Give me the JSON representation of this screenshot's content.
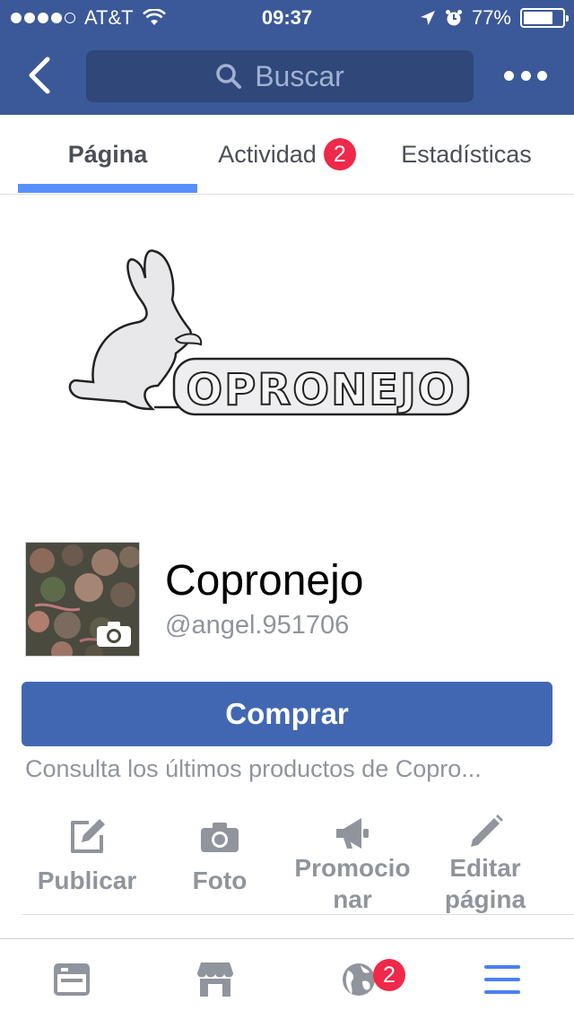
{
  "status_bar": {
    "carrier": "AT&T",
    "time": "09:37",
    "battery": "77%",
    "battery_level": 0.77,
    "signal_bars": 4
  },
  "nav": {
    "search_placeholder": "Buscar",
    "back_icon": "chevron-left-icon",
    "more_icon": "more-icon"
  },
  "tabs": [
    {
      "label": "Página",
      "active": true
    },
    {
      "label": "Actividad",
      "badge": "2"
    },
    {
      "label": "Estadísticas"
    }
  ],
  "page": {
    "name": "Copronejo",
    "username": "@angel.951706",
    "cover_text": "OPRONEJO",
    "buy_label": "Comprar",
    "description": "Consulta los últimos productos de Copro..."
  },
  "actions": [
    {
      "label": "Publicar",
      "icon": "edit-icon"
    },
    {
      "label": "Foto",
      "icon": "camera-icon"
    },
    {
      "label": "Promocio\nnar",
      "icon": "megaphone-icon"
    },
    {
      "label": "Editar\npágina",
      "icon": "pencil-icon"
    }
  ],
  "bottom_nav": [
    {
      "icon": "news-feed-icon"
    },
    {
      "icon": "marketplace-icon"
    },
    {
      "icon": "notifications-globe-icon",
      "badge": "2"
    },
    {
      "icon": "menu-icon",
      "active": true
    }
  ],
  "colors": {
    "brand_blue": "#3b5998",
    "button_blue": "#4267b2",
    "active_tab": "#5890ff",
    "badge_red": "#f02849",
    "muted_text": "#90949c"
  }
}
